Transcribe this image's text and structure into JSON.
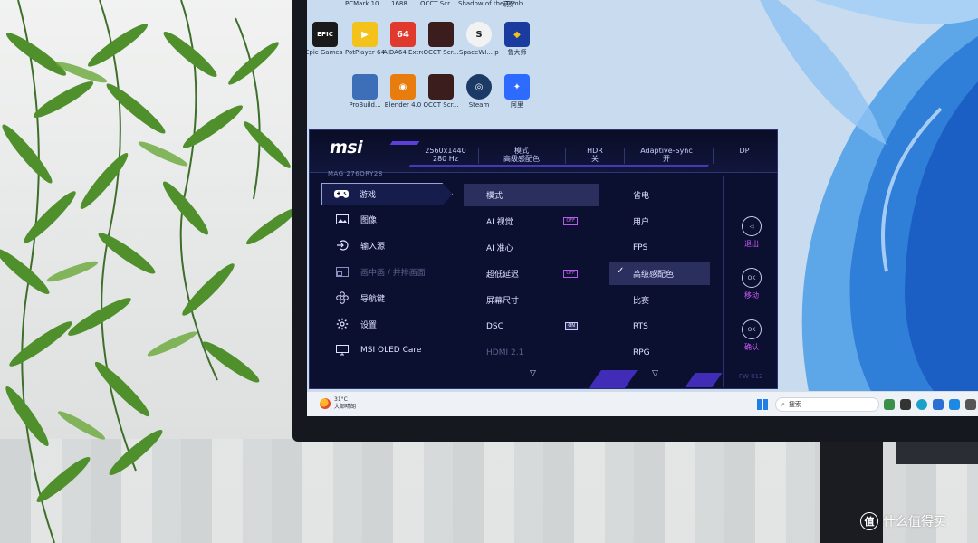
{
  "desktop": {
    "top_row_labels": [
      "PCMark 10",
      "1688",
      "OCCT Scr...",
      "Shadow of the Tomb...",
      "萌芽"
    ],
    "icons": [
      {
        "label": "Epic Games Launcher",
        "glyph": "EPIC",
        "color": "#1a1a1a"
      },
      {
        "label": "PotPlayer 64 bit",
        "glyph": "▶",
        "color": "#f3c21b"
      },
      {
        "label": "AIDA64 Extreme",
        "glyph": "64",
        "color": "#e03a2f"
      },
      {
        "label": "OCCT Scr...",
        "glyph": "",
        "color": "#3b1d1d"
      },
      {
        "label": "SpaceWI... pro",
        "glyph": "S",
        "color": "#f2f2f2"
      },
      {
        "label": "鲁大师",
        "glyph": "◆",
        "color": "#1a3c9e"
      },
      {
        "label": "ProBuild...",
        "glyph": "",
        "color": "#3c6fb8"
      },
      {
        "label": "Blender 4.0",
        "glyph": "◉",
        "color": "#e87d0d"
      },
      {
        "label": "OCCT Scr...",
        "glyph": "",
        "color": "#3b1d1d"
      },
      {
        "label": "Steam",
        "glyph": "◎",
        "color": "#1b3a66"
      },
      {
        "label": "阿里",
        "glyph": "✦",
        "color": "#2d6bff"
      }
    ]
  },
  "osd": {
    "brand": "msi",
    "model": "MAG 276QRY28",
    "status": [
      {
        "top": "2560x1440",
        "bottom": "280 Hz"
      },
      {
        "top": "模式",
        "bottom": "高级感配色"
      },
      {
        "top": "HDR",
        "bottom": "关"
      },
      {
        "top": "Adaptive-Sync",
        "bottom": "开"
      },
      {
        "top": "DP",
        "bottom": ""
      }
    ],
    "main_menu": [
      {
        "label": "游戏",
        "icon": "gamepad-icon",
        "active": true,
        "disabled": false
      },
      {
        "label": "图像",
        "icon": "image-icon",
        "active": false,
        "disabled": false
      },
      {
        "label": "输入源",
        "icon": "input-source-icon",
        "active": false,
        "disabled": false
      },
      {
        "label": "画中画 / 并排画面",
        "icon": "pip-icon",
        "active": false,
        "disabled": true
      },
      {
        "label": "导航键",
        "icon": "navigation-key-icon",
        "active": false,
        "disabled": false
      },
      {
        "label": "设置",
        "icon": "gear-icon",
        "active": false,
        "disabled": false
      },
      {
        "label": "MSI OLED Care",
        "icon": "monitor-icon",
        "active": false,
        "disabled": false
      }
    ],
    "sub_menu": [
      {
        "label": "模式",
        "badge": "",
        "active": true,
        "disabled": false
      },
      {
        "label": "AI 视觉",
        "badge": "OFF",
        "active": false,
        "disabled": false
      },
      {
        "label": "AI 准心",
        "badge": "",
        "active": false,
        "disabled": false
      },
      {
        "label": "超低延迟",
        "badge": "OFF",
        "active": false,
        "disabled": false
      },
      {
        "label": "屏幕尺寸",
        "badge": "",
        "active": false,
        "disabled": false
      },
      {
        "label": "DSC",
        "badge": "ON",
        "active": false,
        "disabled": false
      },
      {
        "label": "HDMI 2.1",
        "badge": "",
        "active": false,
        "disabled": true
      }
    ],
    "options": [
      {
        "label": "省电",
        "selected": false
      },
      {
        "label": "用户",
        "selected": false
      },
      {
        "label": "FPS",
        "selected": false
      },
      {
        "label": "高级感配色",
        "selected": true
      },
      {
        "label": "比赛",
        "selected": false
      },
      {
        "label": "RTS",
        "selected": false
      },
      {
        "label": "RPG",
        "selected": false
      }
    ],
    "check_glyph": "✓",
    "scroll_glyph": "▽",
    "controls": [
      {
        "label": "退出",
        "glyph": "◁"
      },
      {
        "label": "移动",
        "glyph": "OK"
      },
      {
        "label": "确认",
        "glyph": "OK"
      }
    ],
    "firmware": "FW 012"
  },
  "taskbar": {
    "temperature": "31°C",
    "weather": "大部晴朗",
    "search_placeholder": "搜索"
  },
  "watermark": {
    "badge": "值",
    "text": "什么值得买"
  },
  "colors": {
    "osd_bg": "#0c1030",
    "accent_purple": "#d35dff",
    "stripe_violet": "#5b3fd8",
    "selection": "#2a2f5e"
  }
}
